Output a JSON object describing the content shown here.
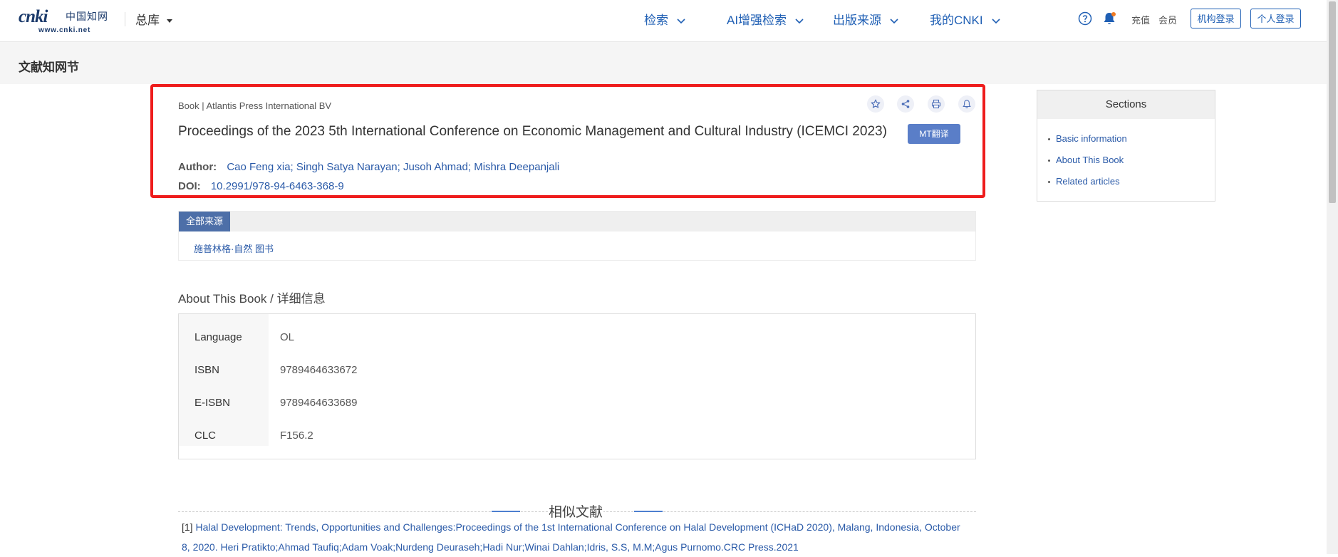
{
  "header": {
    "logo_text": "cnki",
    "logo_cn": "中国知网",
    "logo_url": "www.cnki.net",
    "library_label": "总库",
    "nav": [
      "检索",
      "AI增强检索",
      "出版来源",
      "我的CNKI"
    ],
    "links": {
      "recharge": "充值",
      "member": "会员"
    },
    "buttons": {
      "institution_login": "机构登录",
      "personal_login": "个人登录"
    }
  },
  "band": {
    "title": "文献知网节"
  },
  "document": {
    "type_line": "Book | Atlantis Press International BV",
    "title": "Proceedings of the 2023 5th International Conference on Economic Management and Cultural Industry (ICEMCI 2023)",
    "mt_button": "MT翻译",
    "author_label": "Author:",
    "authors": "Cao Feng xia; Singh Satya Narayan; Jusoh Ahmad; Mishra Deepanjali",
    "doi_label": "DOI:",
    "doi": "10.2991/978-94-6463-368-9"
  },
  "sources": {
    "tab_label": "全部来源",
    "items": [
      "施普林格·自然 图书"
    ]
  },
  "about": {
    "title": "About This Book / 详细信息",
    "rows": [
      {
        "label": "Language",
        "value": "OL"
      },
      {
        "label": "ISBN",
        "value": "9789464633672"
      },
      {
        "label": "E-ISBN",
        "value": "9789464633689"
      },
      {
        "label": "CLC",
        "value": "F156.2"
      }
    ]
  },
  "similar": {
    "title": "相似文献",
    "items": [
      {
        "index": "[1]",
        "text": "Halal Development: Trends, Opportunities and Challenges:Proceedings of the 1st International Conference on Halal Development (ICHaD 2020), Malang, Indonesia, October 8, 2020. Heri Pratikto;Ahmad Taufiq;Adam Voak;Nurdeng Deuraseh;Hadi Nur;Winai Dahlan;Idris, S.S, M.M;Agus Purnomo.CRC Press.2021"
      }
    ]
  },
  "sidebar": {
    "title": "Sections",
    "items": [
      "Basic information",
      "About This Book",
      "Related articles"
    ]
  },
  "colors": {
    "brand": "#1f5fb4",
    "link": "#2a5aa8",
    "highlight_border": "#ee1c1c",
    "mt_button": "#5a7ec8",
    "source_tab": "#4d6fa8"
  },
  "icons": [
    "favorite-star-icon",
    "share-icon",
    "print-icon",
    "notify-bell-icon",
    "help-icon",
    "notification-bell-icon",
    "chevron-down-icon"
  ]
}
